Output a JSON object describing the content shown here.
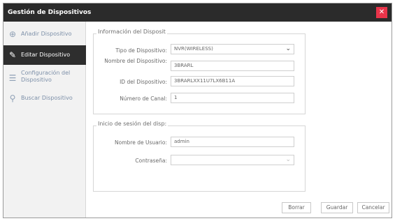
{
  "window": {
    "title": "Gestión de Dispositivos",
    "close_label": "✕"
  },
  "sidebar": {
    "items": [
      {
        "label": "Añadir Dispositivo"
      },
      {
        "label": "Editar Dispositivo"
      },
      {
        "label": "Configuración del Dispositivo"
      },
      {
        "label": "Buscar Dispositivo"
      }
    ]
  },
  "device_info": {
    "title": "Información del Disposit",
    "type_label": "Tipo de Dispositivo:",
    "type_value": "NVR(WIRELESS)",
    "name_label": "Nombre del Dispositivo:",
    "name_value": "3BRARL",
    "id_label": "ID del Dispositivo:",
    "id_value": "3BRARLXX11U7LX6B11A",
    "channels_label": "Número de Canal:",
    "channels_value": "1"
  },
  "login": {
    "title": "Inicio de sesión del disp:",
    "user_label": "Nombre de Usuario:",
    "user_value": "admin",
    "password_label": "Contraseña:",
    "password_value": ""
  },
  "buttons": {
    "delete": "Borrar",
    "save": "Guardar",
    "cancel": "Cancelar"
  }
}
